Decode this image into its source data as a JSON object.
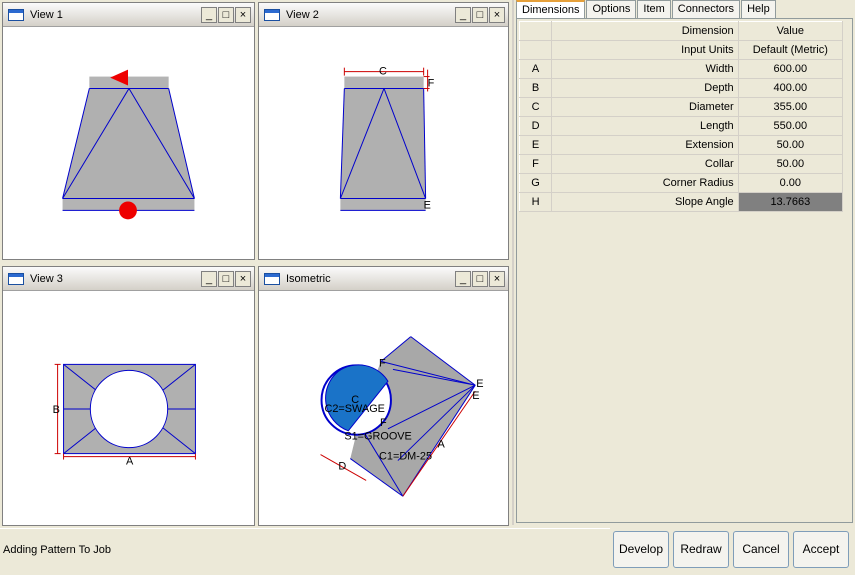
{
  "views": [
    {
      "title": "View 1"
    },
    {
      "title": "View 2"
    },
    {
      "title": "View 3"
    },
    {
      "title": "Isometric"
    }
  ],
  "window_buttons": {
    "minimize": "_",
    "maximize": "□",
    "close": "×"
  },
  "drawing_labels": {
    "view2_c": "C",
    "view2_f": "F",
    "view2_e": "E",
    "view3_b": "B",
    "view3_a": "A",
    "iso_f_top": "F",
    "iso_c": "C",
    "iso_c2": "C2=SWAGE",
    "iso_f_mid": "F",
    "iso_s1": "S1=GROOVE",
    "iso_c1": "C1=DM-25",
    "iso_d": "D",
    "iso_a": "A",
    "iso_e1": "E",
    "iso_e2": "E"
  },
  "panel": {
    "tabs": [
      "Dimensions",
      "Options",
      "Item",
      "Connectors",
      "Help"
    ],
    "header": {
      "dimension": "Dimension",
      "value": "Value"
    },
    "input_units": {
      "label": "Input Units",
      "value": "Default (Metric)"
    },
    "rows": [
      {
        "key": "A",
        "dimension": "Width",
        "value": "600.00"
      },
      {
        "key": "B",
        "dimension": "Depth",
        "value": "400.00"
      },
      {
        "key": "C",
        "dimension": "Diameter",
        "value": "355.00"
      },
      {
        "key": "D",
        "dimension": "Length",
        "value": "550.00"
      },
      {
        "key": "E",
        "dimension": "Extension",
        "value": "50.00"
      },
      {
        "key": "F",
        "dimension": "Collar",
        "value": "50.00"
      },
      {
        "key": "G",
        "dimension": "Corner Radius",
        "value": "0.00"
      },
      {
        "key": "H",
        "dimension": "Slope Angle",
        "value": "13.7663"
      }
    ]
  },
  "status": {
    "text": "Adding Pattern To Job"
  },
  "buttons": {
    "develop": "Develop",
    "redraw": "Redraw",
    "cancel": "Cancel",
    "accept": "Accept"
  },
  "colors": {
    "accent_blue": "#0000cc",
    "dimension_red": "#cc0000",
    "fill_gray": "#b4b4b4",
    "iso_blue": "#1a73c8"
  }
}
